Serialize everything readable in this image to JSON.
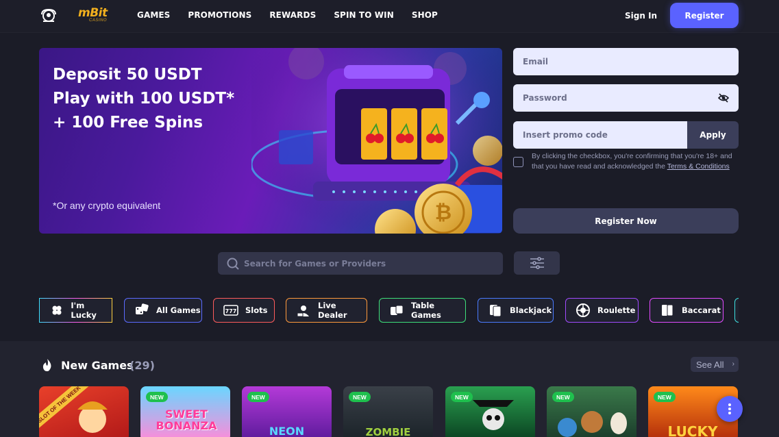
{
  "header": {
    "logo_text": "mBit",
    "logo_sub": "CASINO",
    "nav": [
      "GAMES",
      "PROMOTIONS",
      "REWARDS",
      "SPIN TO WIN",
      "SHOP"
    ],
    "signin_label": "Sign In",
    "register_label": "Register"
  },
  "banner": {
    "line1": "Deposit 50 USDT",
    "line2": "Play with 100 USDT*",
    "line3": "+ 100 Free Spins",
    "note": "*Or any crypto equivalent"
  },
  "form": {
    "email_placeholder": "Email",
    "password_placeholder": "Password",
    "promo_placeholder": "Insert promo code",
    "apply_label": "Apply",
    "terms_text": "By clicking the checkbox, you're confirming that you're 18+ and that you have read and acknowledged the",
    "terms_link": "Terms & Conditions",
    "register_now_label": "Register Now"
  },
  "search": {
    "placeholder": "Search for Games or Providers"
  },
  "categories": [
    {
      "label": "I'm Lucky",
      "icon": "clover-icon",
      "color": "gradient"
    },
    {
      "label": "All Games",
      "icon": "dice-icon",
      "color": "#5b6bff"
    },
    {
      "label": "Slots",
      "icon": "slot-777-icon",
      "color": "#ff5c5c"
    },
    {
      "label": "Live Dealer",
      "icon": "live-icon",
      "color": "#ff9a3c"
    },
    {
      "label": "Table Games",
      "icon": "table-games-icon",
      "color": "#3ee07a"
    },
    {
      "label": "Blackjack",
      "icon": "cards-icon",
      "color": "#4a7bff"
    },
    {
      "label": "Roulette",
      "icon": "roulette-icon",
      "color": "#a24bff"
    },
    {
      "label": "Baccarat",
      "icon": "baccarat-icon",
      "color": "#e24bff"
    }
  ],
  "new_games": {
    "title": "New Games",
    "count": "(29)",
    "see_all": "See All",
    "badge": "NEW",
    "slot_of_week": "SLOT OF THE WEEK",
    "tiles": [
      {
        "name": "tile-slot-of-week",
        "text": ""
      },
      {
        "name": "tile-sweet-bonanza",
        "text": "SWEET BONANZA"
      },
      {
        "name": "tile-neon",
        "text": "NEON"
      },
      {
        "name": "tile-zombie",
        "text": "ZOMBIE"
      },
      {
        "name": "tile-skull",
        "text": ""
      },
      {
        "name": "tile-animals",
        "text": ""
      },
      {
        "name": "tile-lucky",
        "text": "LUCKY"
      }
    ]
  }
}
